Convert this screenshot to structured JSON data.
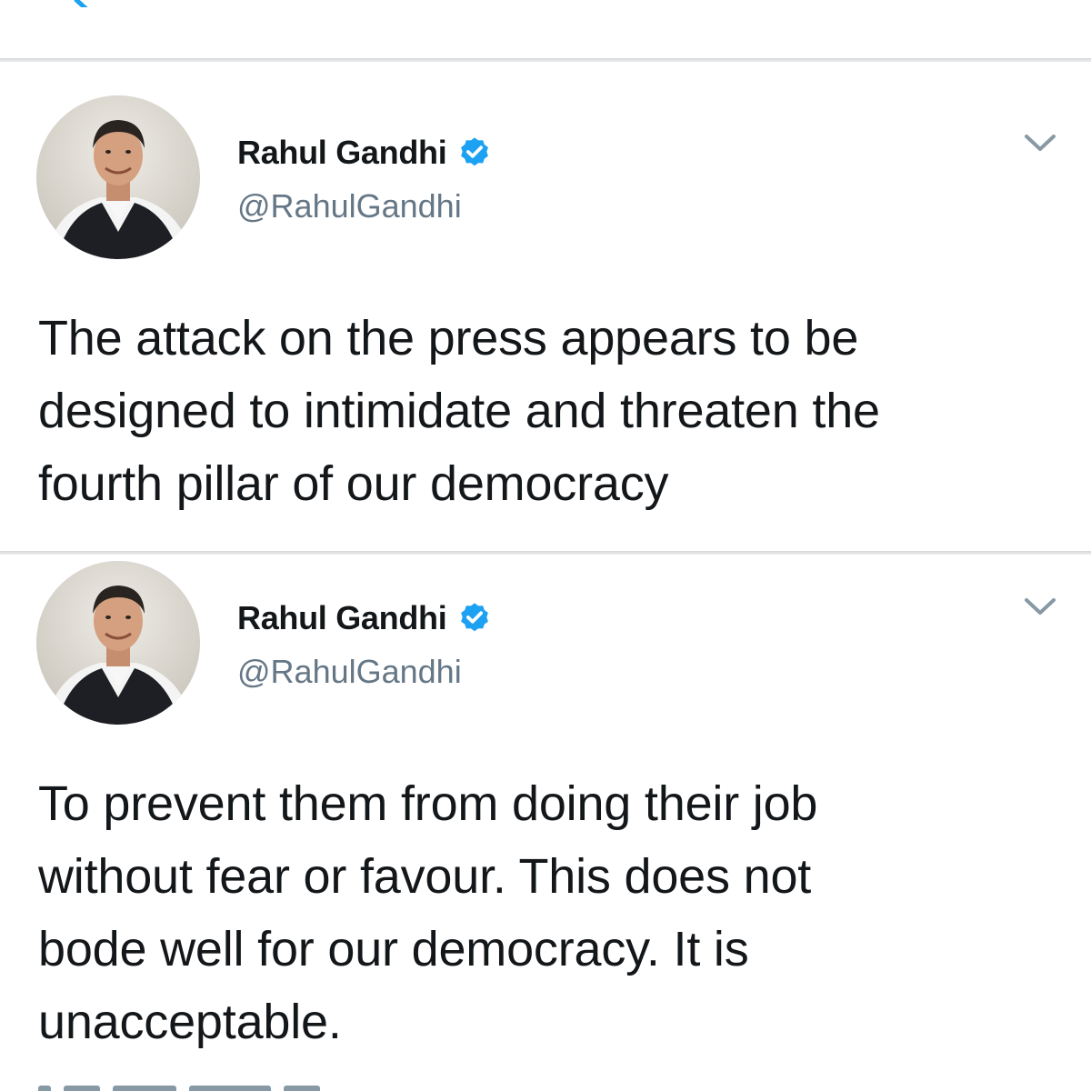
{
  "app": {
    "accent_color": "#1da1f2",
    "text_color": "#14171a",
    "secondary_color": "#657786"
  },
  "top_bar": {
    "back_icon": "arrow-left-icon"
  },
  "tweets": [
    {
      "display_name": "Rahul Gandhi",
      "handle": "@RahulGandhi",
      "verified_icon": "verified-badge-icon",
      "menu_icon": "chevron-down-icon",
      "avatar": "profile-photo",
      "text_lines": [
        "The attack on the press appears to be",
        "designed to intimidate and threaten the",
        "fourth pillar of our democracy"
      ]
    },
    {
      "display_name": "Rahul Gandhi",
      "handle": "@RahulGandhi",
      "verified_icon": "verified-badge-icon",
      "menu_icon": "chevron-down-icon",
      "avatar": "profile-photo",
      "text_lines": [
        "To prevent them from doing their job",
        "without fear or favour. This does not",
        "bode well for our democracy. It is",
        "unacceptable."
      ]
    }
  ]
}
